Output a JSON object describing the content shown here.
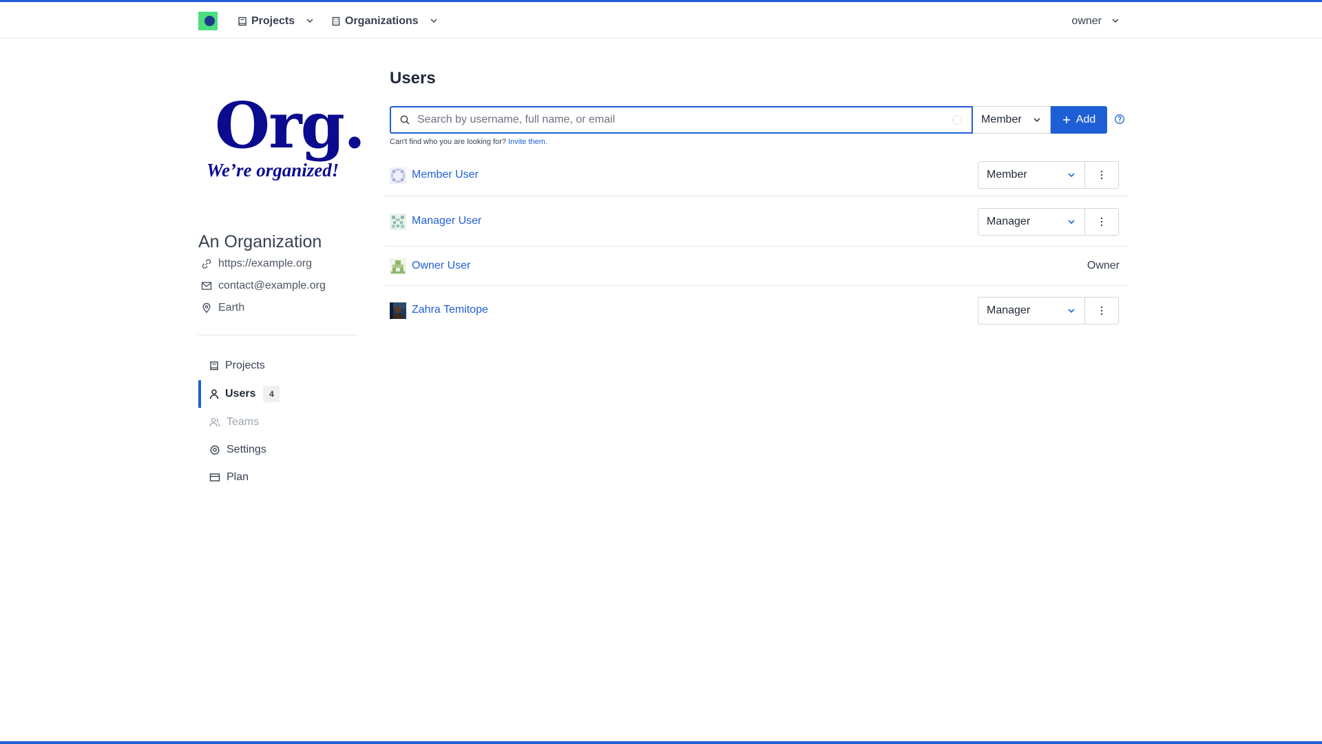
{
  "navbar": {
    "projects_label": "Projects",
    "organizations_label": "Organizations",
    "user_label": "owner"
  },
  "org": {
    "logo_text": "Org.",
    "logo_tagline": "We’re organized!",
    "name": "An Organization",
    "url": "https://example.org",
    "email": "contact@example.org",
    "location": "Earth"
  },
  "sidebar": {
    "items": [
      {
        "label": "Projects",
        "icon": "book-icon"
      },
      {
        "label": "Users",
        "icon": "user-icon",
        "count": "4",
        "active": true
      },
      {
        "label": "Teams",
        "icon": "users-icon",
        "disabled": true
      },
      {
        "label": "Settings",
        "icon": "gear-icon"
      },
      {
        "label": "Plan",
        "icon": "card-icon"
      }
    ]
  },
  "main": {
    "title": "Users",
    "search_placeholder": "Search by username, full name, or email",
    "search_value": "",
    "role_select": "Member",
    "add_label": "Add",
    "hint_text": "Can't find who you are looking for?",
    "hint_link": "Invite them."
  },
  "users": [
    {
      "name": "Member User",
      "role": "Member",
      "editable": true
    },
    {
      "name": "Manager User",
      "role": "Manager",
      "editable": true
    },
    {
      "name": "Owner User",
      "role": "Owner",
      "editable": false
    },
    {
      "name": "Zahra Temitope",
      "role": "Manager",
      "editable": true
    }
  ],
  "colors": {
    "accent": "#1f5fd6",
    "logo_green": "#4ade80",
    "logo_navy": "#0b0b8f"
  }
}
